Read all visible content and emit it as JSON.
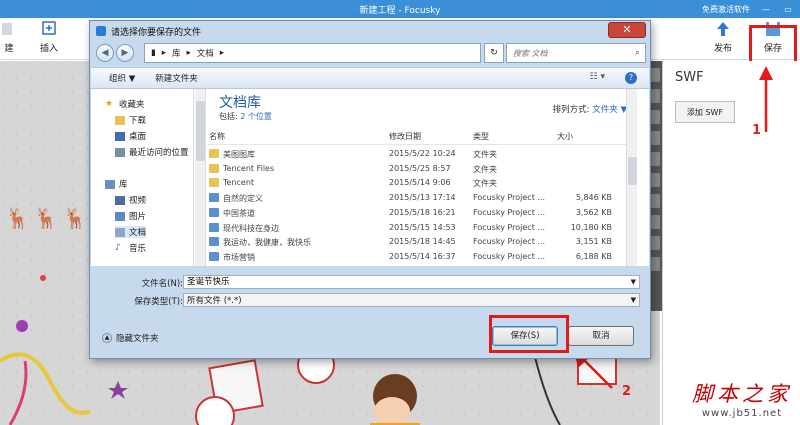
{
  "app": {
    "title": "新建工程 - Focusky",
    "promo": "免费激活软件",
    "toolbar": {
      "left_btn_partial": "建",
      "insert": "插入",
      "publish": "发布",
      "save": "保存"
    },
    "panel": {
      "title": "SWF",
      "add_swf": "添加 SWF"
    }
  },
  "annotations": {
    "step1": "1",
    "step2": "2"
  },
  "dialog": {
    "title": "请选择你要保存的文件",
    "address": {
      "root": "库",
      "folder": "文档"
    },
    "search_placeholder": "搜索 文档",
    "commands": {
      "organize": "组织 ▼",
      "new_folder": "新建文件夹"
    },
    "nav": {
      "favorites": "收藏夹",
      "downloads": "下载",
      "desktop": "桌面",
      "recent": "最近访问的位置",
      "libraries": "库",
      "videos": "视频",
      "pictures": "图片",
      "documents": "文档",
      "music": "音乐"
    },
    "library": {
      "title": "文档库",
      "includes": "包括:",
      "locations": "2 个位置",
      "arrange_label": "排列方式:",
      "arrange_value": "文件夹 ▼"
    },
    "columns": {
      "name": "名称",
      "date": "修改日期",
      "type": "类型",
      "size": "大小"
    },
    "files": [
      {
        "name": "美图图库",
        "date": "2015/5/22 10:24",
        "type": "文件夹",
        "size": "",
        "kind": "folder"
      },
      {
        "name": "Tencent Files",
        "date": "2015/5/25 8:57",
        "type": "文件夹",
        "size": "",
        "kind": "folder"
      },
      {
        "name": "Tencent",
        "date": "2015/5/14 9:06",
        "type": "文件夹",
        "size": "",
        "kind": "folder"
      },
      {
        "name": "自然的定义",
        "date": "2015/5/13 17:14",
        "type": "Focusky Project ...",
        "size": "5,846 KB",
        "kind": "file"
      },
      {
        "name": "中国茶道",
        "date": "2015/5/18 16:21",
        "type": "Focusky Project ...",
        "size": "3,562 KB",
        "kind": "file"
      },
      {
        "name": "现代科技在身边",
        "date": "2015/5/15 14:53",
        "type": "Focusky Project ...",
        "size": "10,180 KB",
        "kind": "file"
      },
      {
        "name": "我运动，我健康，我快乐",
        "date": "2015/5/18 14:45",
        "type": "Focusky Project ...",
        "size": "3,151 KB",
        "kind": "file"
      },
      {
        "name": "市场营销",
        "date": "2015/5/14 16:37",
        "type": "Focusky Project ...",
        "size": "6,188 KB",
        "kind": "file"
      }
    ],
    "filename_label": "文件名(N):",
    "filename_value": "圣诞节快乐",
    "filetype_label": "保存类型(T):",
    "filetype_value": "所有文件 (*.*)",
    "hide_folders": "隐藏文件夹",
    "save_button": "保存(S)",
    "cancel_button": "取消"
  },
  "watermark": {
    "main": "脚本之家",
    "url": "www.jb51.net"
  }
}
